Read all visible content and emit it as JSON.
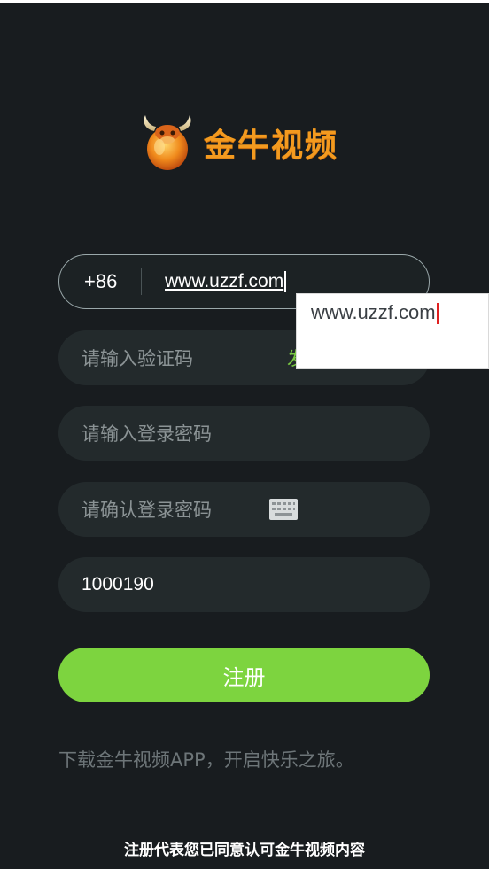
{
  "app": {
    "brand_name": "金牛视频",
    "brand_color": "#f39a1f",
    "accent_color": "#7dd43f",
    "logo_icon": "bull-icon"
  },
  "form": {
    "phone": {
      "country_code": "+86",
      "value": "www.uzzf.com"
    },
    "autocomplete_suggestion": "www.uzzf.com",
    "verification_code": {
      "placeholder": "请输入验证码",
      "send_label": "发"
    },
    "password": {
      "placeholder": "请输入登录密码"
    },
    "confirm_password": {
      "placeholder": "请确认登录密码",
      "keyboard_icon": "keyboard-icon"
    },
    "invite_code": {
      "value": "1000190"
    },
    "register_label": "注册"
  },
  "footer": {
    "promo_text": "下载金牛视频APP，开启快乐之旅。",
    "terms_text": "注册代表您已同意认可金牛视频内容"
  }
}
